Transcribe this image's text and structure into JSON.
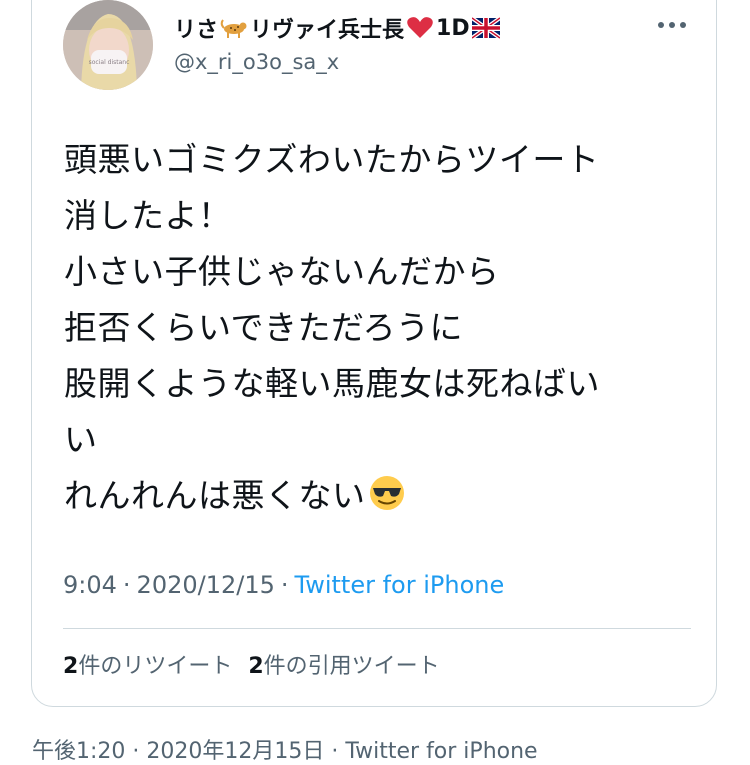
{
  "tweet": {
    "author": {
      "name_part1": "リさ",
      "name_emoji1": "leopard",
      "name_part2": "リヴァイ兵士長",
      "name_emoji2": "red-heart",
      "name_part3": "1D",
      "name_emoji3": "uk-flag",
      "handle": "@x_ri_o3o_sa_x",
      "avatar_mask_text": "social distanc"
    },
    "text_lines": [
      "頭悪いゴミクズわいたからツイート",
      "消したよ！",
      "小さい子供じゃないんだから",
      "拒否くらいできただろうに",
      "股開くような軽い馬鹿女は死ねばい",
      "い",
      "れんれんは悪くない"
    ],
    "text_end_emoji": "smiling-face-with-sunglasses",
    "time": "9:04",
    "date": "2020/12/15",
    "source": "Twitter for iPhone",
    "retweet_count": "2",
    "retweet_label": "件のリツイート",
    "quote_count": "2",
    "quote_label": "件の引用ツイート"
  },
  "footer": {
    "text": "午後1:20 · 2020年12月15日 · Twitter for iPhone"
  },
  "colors": {
    "text": "#0f1419",
    "secondary": "#536471",
    "link": "#1d9bf0",
    "border": "#cfd9de"
  }
}
